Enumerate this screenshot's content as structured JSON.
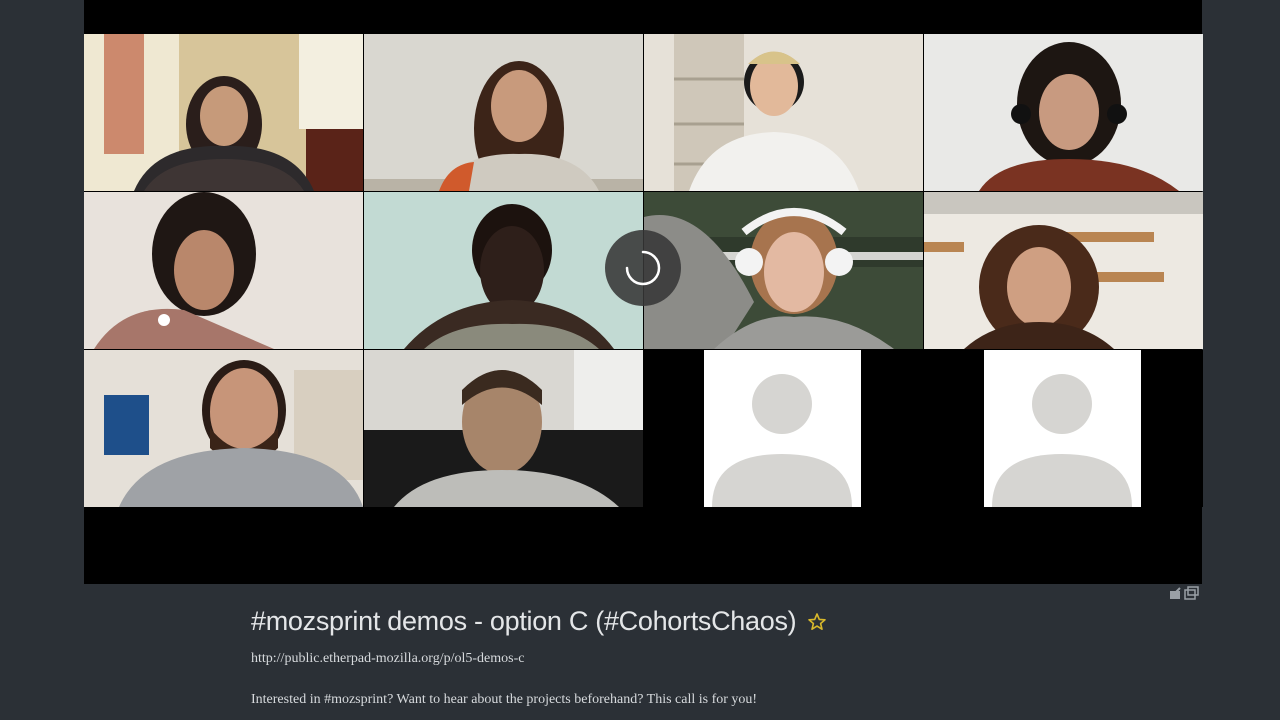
{
  "video": {
    "participants": [
      {
        "name": "participant-1"
      },
      {
        "name": "participant-2"
      },
      {
        "name": "participant-3"
      },
      {
        "name": "participant-4"
      },
      {
        "name": "participant-5"
      },
      {
        "name": "participant-6"
      },
      {
        "name": "participant-7"
      },
      {
        "name": "participant-8"
      },
      {
        "name": "participant-9"
      },
      {
        "name": "participant-10"
      },
      {
        "name": "participant-11-placeholder"
      },
      {
        "name": "participant-12-placeholder"
      }
    ],
    "loading_icon": "loading-spinner-icon",
    "popout_icons": [
      "share-icon",
      "popout-icon"
    ]
  },
  "event": {
    "title": "#mozsprint demos - option C (#CohortsChaos)",
    "star_icon": "star-outline-icon",
    "star_color": "#d8b82b",
    "link": "http://public.etherpad-mozilla.org/p/ol5-demos-c",
    "description": "Interested in #mozsprint? Want to hear about the projects beforehand? This call is for you!"
  }
}
